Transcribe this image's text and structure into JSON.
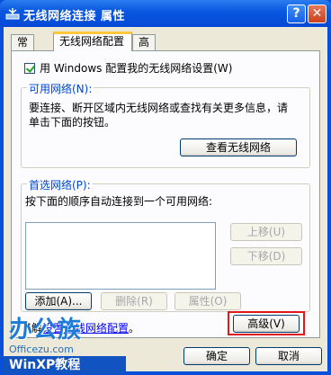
{
  "window": {
    "title": "无线网络连接 属性",
    "help_label": "?",
    "close_label": "✕"
  },
  "tabs": [
    {
      "label": "常规"
    },
    {
      "label": "无线网络配置"
    },
    {
      "label": "高级"
    }
  ],
  "config": {
    "checkbox_label": "用 Windows 配置我的无线网络设置(W)",
    "checked": true
  },
  "available": {
    "legend": "可用网络(N):",
    "description_1": "要连接、断开区域内无线网络或查找有关更多信息，请",
    "description_2": "单击下面的按钮。",
    "view_button": "查看无线网络"
  },
  "preferred": {
    "legend": "首选网络(P):",
    "description": "按下面的顺序自动连接到一个可用网络:",
    "move_up": "上移(U)",
    "move_down": "下移(D)",
    "add": "添加(A)...",
    "remove": "删除(R)",
    "properties": "属性(O)"
  },
  "footer": {
    "learn_prefix": "了解",
    "learn_link": "设置无线网络配置",
    "learn_suffix": "。",
    "advanced_button": "高级(V)",
    "ok_button": "确定",
    "cancel_button": "取消"
  },
  "watermark": {
    "brand": "办公族",
    "site": "Officezu.com",
    "banner": "WinXP教程"
  }
}
